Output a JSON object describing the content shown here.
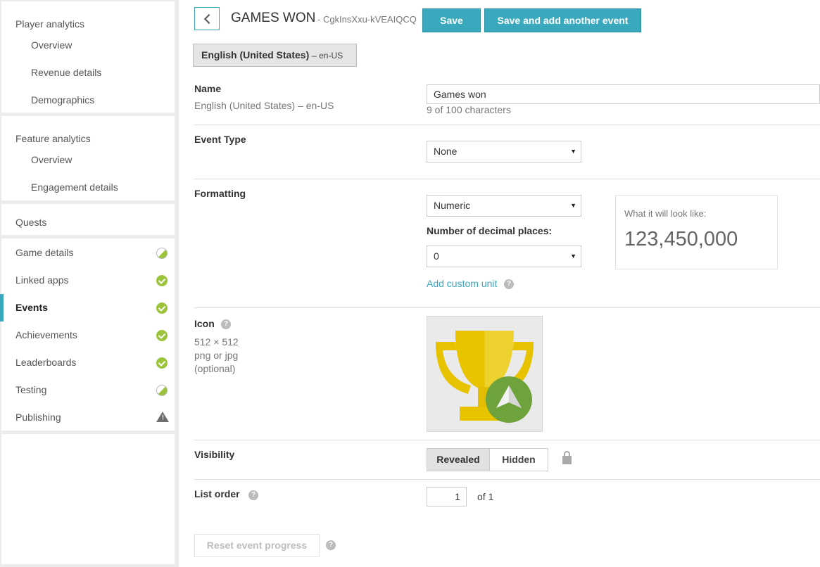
{
  "sidebar": {
    "player_analytics": {
      "heading": "Player analytics",
      "items": [
        "Overview",
        "Revenue details",
        "Demographics"
      ]
    },
    "feature_analytics": {
      "heading": "Feature analytics",
      "items": [
        "Overview",
        "Engagement details"
      ]
    },
    "quests": "Quests",
    "nav": [
      {
        "label": "Game details",
        "status": "partial-icon"
      },
      {
        "label": "Linked apps",
        "status": "check-icon"
      },
      {
        "label": "Events",
        "status": "check-icon"
      },
      {
        "label": "Achievements",
        "status": "check-icon"
      },
      {
        "label": "Leaderboards",
        "status": "check-icon"
      },
      {
        "label": "Testing",
        "status": "partial-icon"
      },
      {
        "label": "Publishing",
        "status": "warning-icon"
      }
    ],
    "active": "Events",
    "accent_color": "#3aa9bd",
    "check_color": "#9cc43a"
  },
  "header": {
    "title": "GAMES WON",
    "event_id": "- CgkInsXxu-kVEAIQCQ",
    "save_label": "Save",
    "save_add_label": "Save and add another event"
  },
  "language": {
    "name": "English (United States)",
    "code": "– en-US"
  },
  "name_row": {
    "label": "Name",
    "locale": "English (United States) – en-US",
    "value": "Games won",
    "char_count": "9 of 100 characters"
  },
  "event_type": {
    "label": "Event Type",
    "selected": "None"
  },
  "formatting": {
    "label": "Formatting",
    "selected": "Numeric",
    "decimal_label": "Number of decimal places:",
    "decimal_selected": "0",
    "custom_unit": "Add custom unit",
    "preview_label": "What it will look like:",
    "preview_value": "123,450,000"
  },
  "icon_row": {
    "label": "Icon",
    "size": "512 × 512",
    "formats": "png or jpg",
    "optional": "(optional)"
  },
  "visibility": {
    "label": "Visibility",
    "options": [
      "Revealed",
      "Hidden"
    ],
    "selected": "Revealed"
  },
  "list_order": {
    "label": "List order",
    "value": "1",
    "of": "of 1"
  },
  "reset_label": "Reset event progress",
  "help_glyph": "?"
}
